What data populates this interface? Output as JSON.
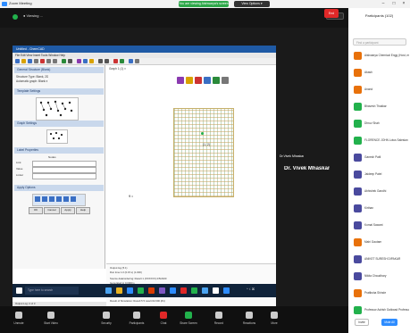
{
  "window": {
    "title": "Zoom Meeting"
  },
  "share_banner": {
    "sharing_label": "You are viewing Aishwarya's screen",
    "stop_label": "View Options ▾"
  },
  "meeting": {
    "viewing_label": "●  Viewing ...",
    "view_button": "View"
  },
  "app": {
    "title": "Untitled - ChemCAD",
    "menu": "File  Edit  View  Insert  Tools  Window  Help",
    "panel": {
      "section1": "General Structure (Blank)",
      "s1_line1": "Structure Type: Blank, 2D",
      "s1_line2": "Automatic graph: Blank  ▾",
      "section2": "Template Settings",
      "section3": "Graph Settings",
      "section4": "Label Properties",
      "section5": "Apply Options",
      "field_label": "Nodes",
      "field1": "Link",
      "field2": "Value",
      "field3": "Linker",
      "btn1": "OK",
      "btn2": "Cancel",
      "btn3": "Apply",
      "btn4": "Help"
    },
    "graph_tab": "Graph 1 (1)  ×",
    "axis_label": "9 •",
    "point_label": "(1, 2)",
    "log": {
      "line1": "Output log (5.1)",
      "line2": "   Run time 1.0  (0.15 s)  (1.000)",
      "line3": "Source data/ordering: Result 1 (XXXXXX) 2/5/2020",
      "line4": "Generated in 0.0000 s",
      "line5": "A Linear Grid: Algebra of sets (00,0000) - 2000.000 (1.0, 0.00) for xxxxx grid  (00000000,0000) = 0.000",
      "line6": "Simulation results: 1 feasible run",
      "line7": "Simulated results ... finished set for row 6000",
      "line8": "Result of Simulation: Result 5    5 result    #2.000 (#1)"
    },
    "status": "Output Log: 2 of 3"
  },
  "taskbar": {
    "search": "Type here to search",
    "clock": "^ ☇ ⌘ "
  },
  "speaker": {
    "label": "Dr.Vivek Mhaskar",
    "name": "Dr. Vivek Mhaskar"
  },
  "controls": [
    {
      "label": "Unmute",
      "color": "#cccccc"
    },
    {
      "label": "Start Video",
      "color": "#cccccc"
    },
    {
      "label": "Security",
      "color": "#cccccc"
    },
    {
      "label": "Participants",
      "color": "#cccccc"
    },
    {
      "label": "Chat",
      "color": "#e02828"
    },
    {
      "label": "Share Screen",
      "color": "#22b14c"
    },
    {
      "label": "Record",
      "color": "#cccccc"
    },
    {
      "label": "Reactions",
      "color": "#cccccc"
    },
    {
      "label": "More",
      "color": "#cccccc"
    }
  ],
  "end_label": "End",
  "participants": {
    "title": "Participants (102)",
    "search_placeholder": "Find a participant",
    "rows": [
      {
        "name": "Aishwarya Chemical Engg (Host, me)",
        "color": "#e8710a"
      },
      {
        "name": "Akash",
        "color": "#e8710a"
      },
      {
        "name": "Anand",
        "color": "#e8710a"
      },
      {
        "name": "Bhavesh Thakkar",
        "color": "#22b14c"
      },
      {
        "name": "Dhruv Shah",
        "color": "#22b14c"
      },
      {
        "name": "FLORENCE JOHN Lotus Salesian",
        "color": "#22b14c"
      },
      {
        "name": "Ganesh Patil",
        "color": "#4a4a9e"
      },
      {
        "name": "Jaideep Patel",
        "color": "#4a4a9e"
      },
      {
        "name": "Abhishek Gandhi",
        "color": "#4a4a9e"
      },
      {
        "name": "Kirthan",
        "color": "#4a4a9e"
      },
      {
        "name": "Komal Sawant",
        "color": "#4a4a9e"
      },
      {
        "name": "Mahi Gautam",
        "color": "#e8710a"
      },
      {
        "name": "ANIKET SURESH DIPAKAR",
        "color": "#4a4a9e"
      },
      {
        "name": "Nikita Chaudhary",
        "color": "#4a4a9e"
      },
      {
        "name": "Pratiksha Shinde",
        "color": "#e8710a"
      },
      {
        "name": "Professor Ashish Gaikwad Professor",
        "color": "#22b14c"
      }
    ],
    "invite_label": "Invite",
    "mute_label": "Mute All"
  }
}
